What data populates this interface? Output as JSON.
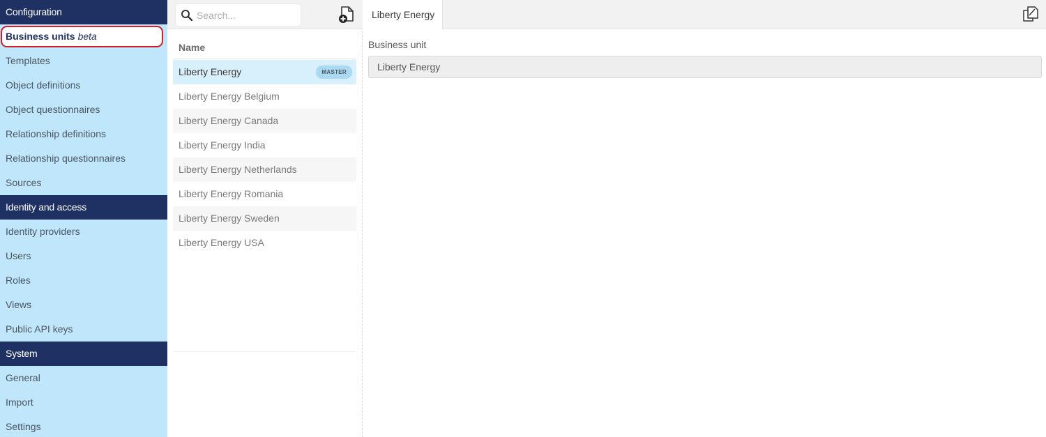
{
  "sidebar": {
    "sections": [
      {
        "title": "Configuration",
        "items": [
          {
            "label": "Business units",
            "suffix": "beta",
            "active": true
          },
          {
            "label": "Templates"
          },
          {
            "label": "Object definitions"
          },
          {
            "label": "Object questionnaires"
          },
          {
            "label": "Relationship definitions"
          },
          {
            "label": "Relationship questionnaires"
          },
          {
            "label": "Sources"
          }
        ]
      },
      {
        "title": "Identity and access",
        "items": [
          {
            "label": "Identity providers"
          },
          {
            "label": "Users"
          },
          {
            "label": "Roles"
          },
          {
            "label": "Views"
          },
          {
            "label": "Public API keys"
          }
        ]
      },
      {
        "title": "System",
        "items": [
          {
            "label": "General"
          },
          {
            "label": "Import"
          },
          {
            "label": "Settings"
          }
        ]
      }
    ]
  },
  "list": {
    "search": {
      "placeholder": "Search...",
      "value": "",
      "icon": "search-icon"
    },
    "add_icon": "add-document-icon",
    "header": "Name",
    "rows": [
      {
        "name": "Liberty Energy",
        "badge": "MASTER",
        "selected": true
      },
      {
        "name": "Liberty Energy Belgium"
      },
      {
        "name": "Liberty Energy Canada"
      },
      {
        "name": "Liberty Energy India"
      },
      {
        "name": "Liberty Energy Netherlands"
      },
      {
        "name": "Liberty Energy Romania"
      },
      {
        "name": "Liberty Energy Sweden"
      },
      {
        "name": "Liberty Energy USA"
      }
    ]
  },
  "detail": {
    "tab_label": "Liberty Energy",
    "copy_icon": "copy-icon",
    "field_label": "Business unit",
    "field_value": "Liberty Energy"
  },
  "colors": {
    "sidebar_bg": "#bfe6fb",
    "section_header_bg": "#1f3163",
    "active_outline": "#d0202a",
    "selected_row_bg": "#d8f0fb",
    "badge_bg": "#aad9f2"
  }
}
